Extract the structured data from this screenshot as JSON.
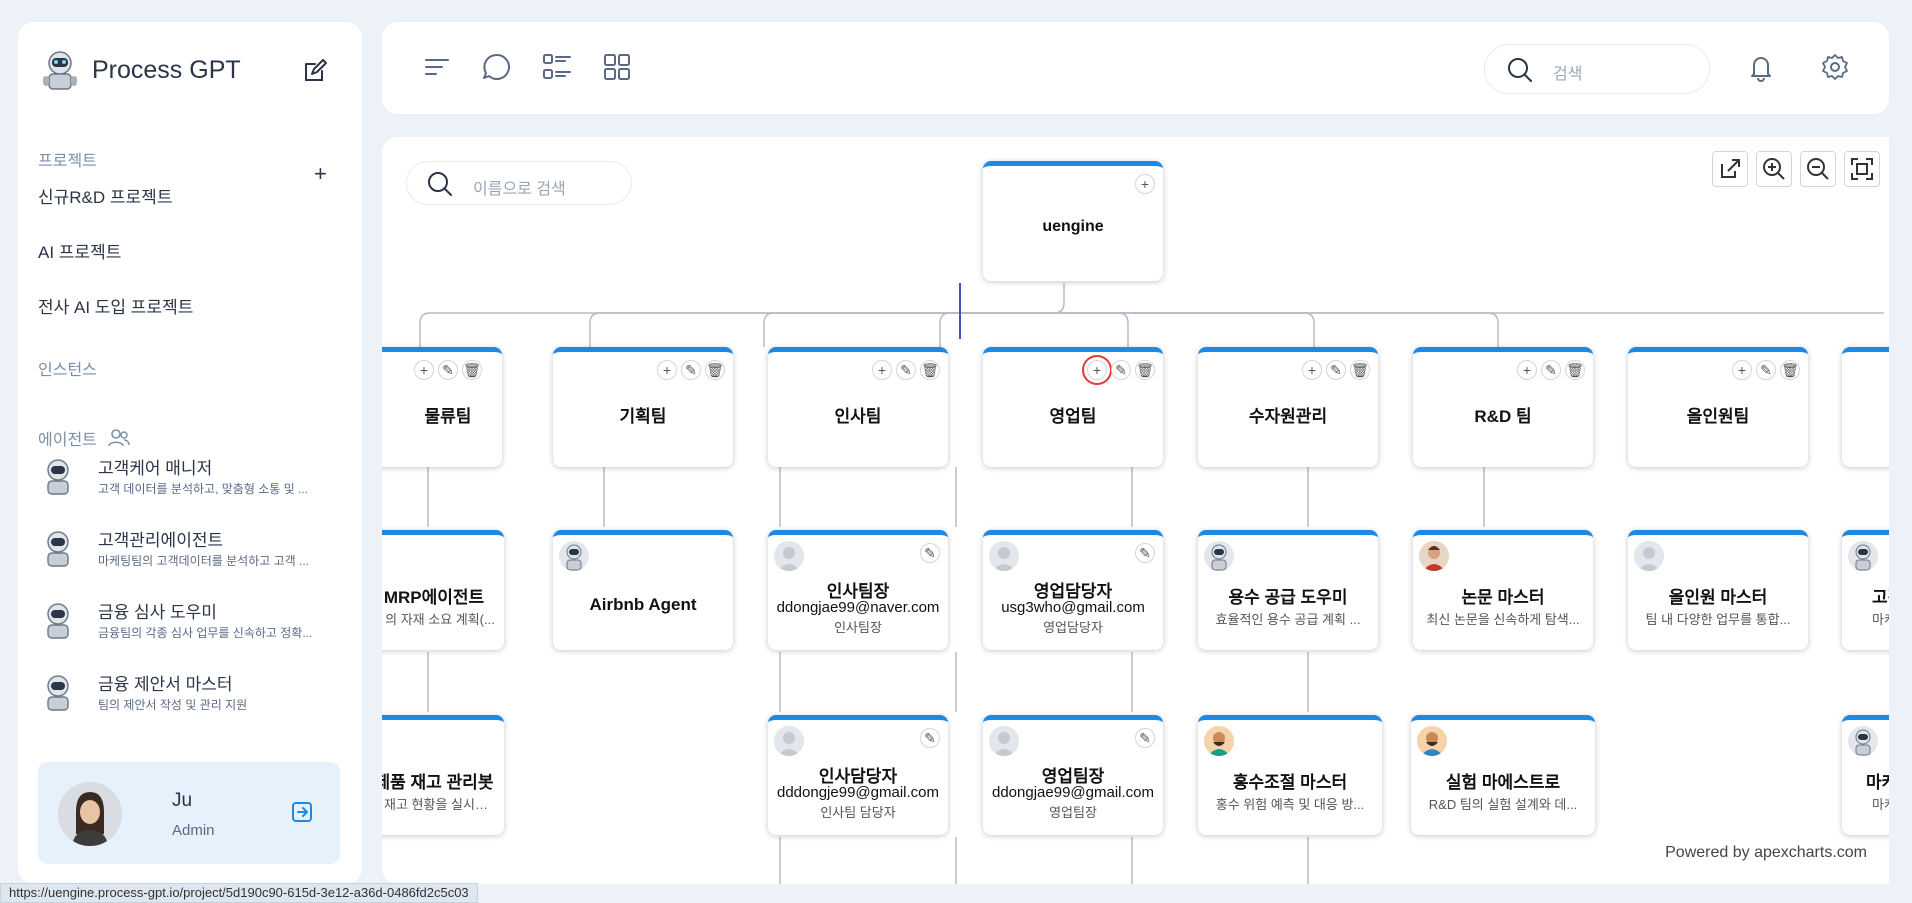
{
  "app": {
    "title": "Process GPT"
  },
  "sidebar": {
    "projects_label": "프로젝트",
    "add_label": "+",
    "projects": [
      "신규R&D 프로젝트",
      "AI 프로젝트",
      "전사 AI 도입 프로젝트"
    ],
    "instances_label": "인스턴스",
    "agents_label": "에이전트",
    "agents": [
      {
        "name": "고객케어 매니저",
        "desc": "고객 데이터를 분석하고, 맞춤형 소통 및 ..."
      },
      {
        "name": "고객관리에이전트",
        "desc": "마케팅팀의 고객데이터를 분석하고 고객 ..."
      },
      {
        "name": "금융 심사 도우미",
        "desc": "금융팀의 각종 심사 업무를 신속하고 정확..."
      },
      {
        "name": "금융 제안서 마스터",
        "desc": "팀의 제안서 작성 및 관리 지원"
      }
    ],
    "user": {
      "name": "Ju",
      "role": "Admin"
    }
  },
  "topbar": {
    "search_placeholder": "검색"
  },
  "chart": {
    "search_placeholder": "이름으로 검색",
    "root": {
      "title": "uengine"
    },
    "teams": [
      "물류팀",
      "기획팀",
      "인사팀",
      "영업팀",
      "수자원관리",
      "R&D 팀",
      "올인원팀"
    ],
    "members": [
      {
        "name": "MRP에이전트",
        "desc": "의 자재 소요 계획(..."
      },
      {
        "name": "Airbnb Agent"
      },
      {
        "name": "인사팀장",
        "email": "ddongjae99@naver.com",
        "role": "인사팀장"
      },
      {
        "name": "영업담당자",
        "email": "usg3who@gmail.com",
        "role": "영업담당자"
      },
      {
        "name": "용수 공급 도우미",
        "desc": "효율적인 용수 공급 계획 ..."
      },
      {
        "name": "논문 마스터",
        "desc": "최신 논문을 신속하게 탐색..."
      },
      {
        "name": "올인원 마스터",
        "desc": "팀 내 다양한 업무를 통합..."
      },
      {
        "name": "고객",
        "desc": "마케팅"
      }
    ],
    "members2": [
      {
        "name": "제품 재고 관리봇",
        "desc": "재고 현황을 실시간으..."
      },
      {
        "name": "인사담당자",
        "email": "dddongje99@gmail.com",
        "role": "인사팀 담당자"
      },
      {
        "name": "영업팀장",
        "email": "ddongjae99@gmail.com",
        "role": "영업팀장"
      },
      {
        "name": "홍수조절 마스터",
        "desc": "홍수 위험 예측 및 대응 방..."
      },
      {
        "name": "실험 마에스트로",
        "desc": "R&D 팀의 실험 설계와 데..."
      },
      {
        "name": "마케팅",
        "desc": "마케팅"
      }
    ],
    "powered_by": "Powered by apexcharts.com"
  },
  "status_url": "https://uengine.process-gpt.io/project/5d190c90-615d-3e12-a36d-0486fd2c5c03",
  "colors": {
    "accent": "#1e88e5",
    "highlight": "#e53935"
  }
}
